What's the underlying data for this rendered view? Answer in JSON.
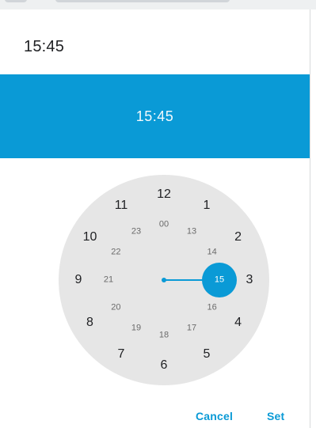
{
  "dialog": {
    "title": "15:45",
    "header_time": "15:45",
    "cancel_label": "Cancel",
    "set_label": "Set"
  },
  "clock": {
    "selected": "15",
    "outer_hours": [
      "12",
      "1",
      "2",
      "3",
      "4",
      "5",
      "6",
      "7",
      "8",
      "9",
      "10",
      "11"
    ],
    "inner_hours": [
      "00",
      "13",
      "14",
      "15",
      "16",
      "17",
      "18",
      "19",
      "20",
      "21",
      "22",
      "23"
    ]
  },
  "colors": {
    "accent": "#0a9ad6",
    "dial_background": "#e6e6e6",
    "text_primary": "#202124",
    "text_secondary": "#6b6b6b"
  }
}
